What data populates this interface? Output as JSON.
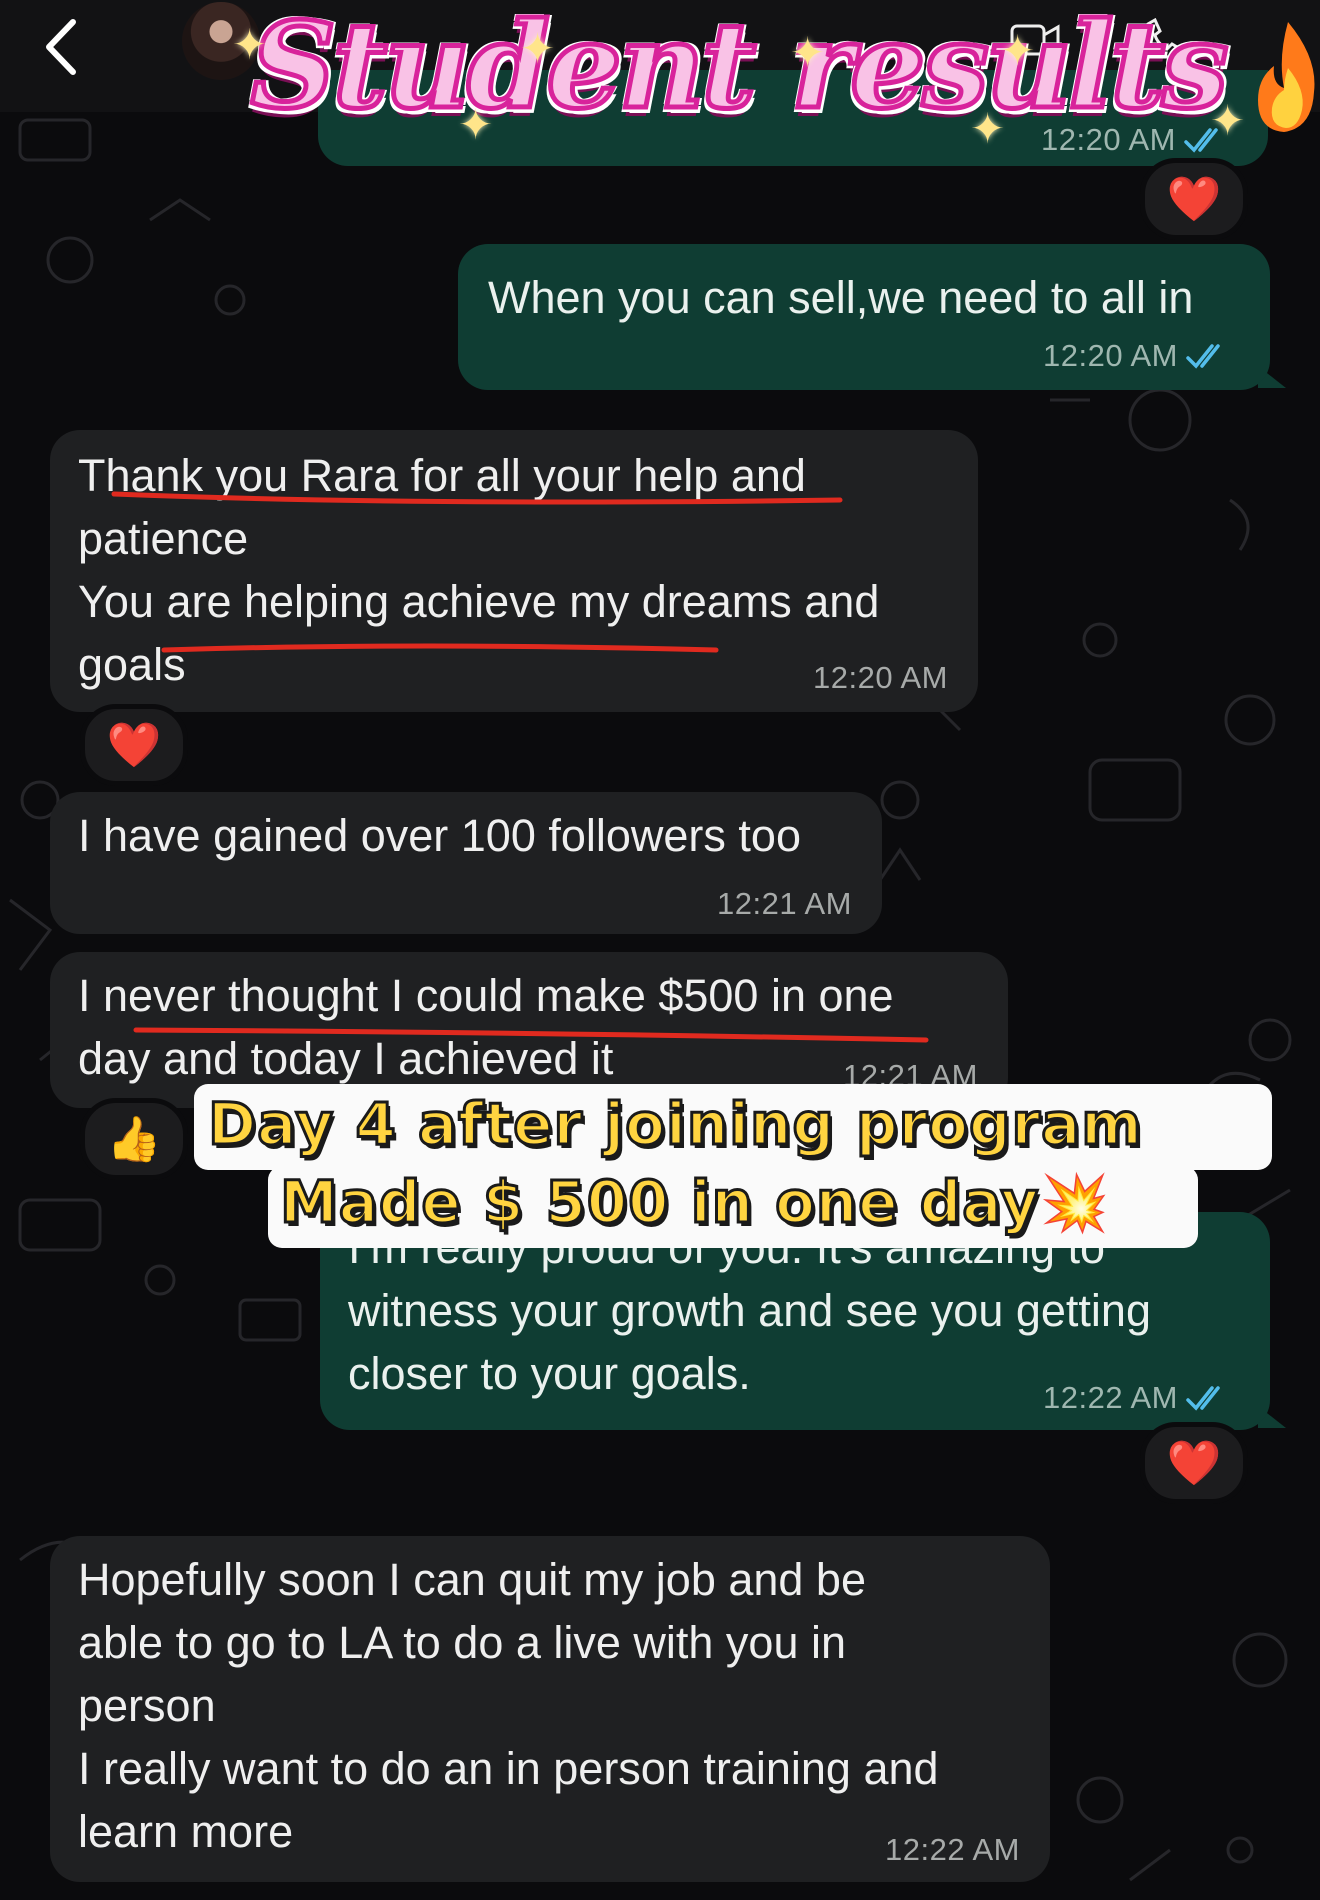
{
  "title": {
    "text": "Student results"
  },
  "header": {
    "partial_time": "12:20 AM"
  },
  "messages": [
    {
      "direction": "out",
      "text": "When you can sell,we need to all in",
      "time": "12:20 AM"
    },
    {
      "direction": "in",
      "lines": [
        "Thank you Rara for all your help and",
        "patience",
        "You are helping achieve my dreams and",
        "goals"
      ],
      "time": "12:20 AM"
    },
    {
      "direction": "in",
      "text": "I have gained over 100 followers too",
      "time": "12:21 AM"
    },
    {
      "direction": "in",
      "lines": [
        "I never thought I could make $500 in one",
        "day and today I achieved it"
      ],
      "time": "12:21 AM"
    },
    {
      "direction": "out",
      "lines": [
        "I’m really proud of you. It’s amazing to",
        "witness your growth and see you getting",
        "closer to your goals."
      ],
      "time": "12:22 AM"
    },
    {
      "direction": "in",
      "lines": [
        "Hopefully soon I can quit my job and be",
        "able to go to LA to do a live with you in",
        "person",
        "I really want to do an in person training and",
        "learn more"
      ],
      "time": "12:22 AM"
    }
  ],
  "reactions": {
    "heart": "❤️",
    "thumbs": "👍"
  },
  "caption": {
    "line1": "Day 4 after joining program",
    "line2": "Made  $ 500 in one day",
    "line2_emoji": "💥"
  },
  "colors": {
    "incoming_bubble": "#1f2022",
    "outgoing_bubble": "#0f3d33",
    "read_ticks": "#53bdeb",
    "underline": "#e02a1f",
    "title_pink": "#d8239b"
  }
}
